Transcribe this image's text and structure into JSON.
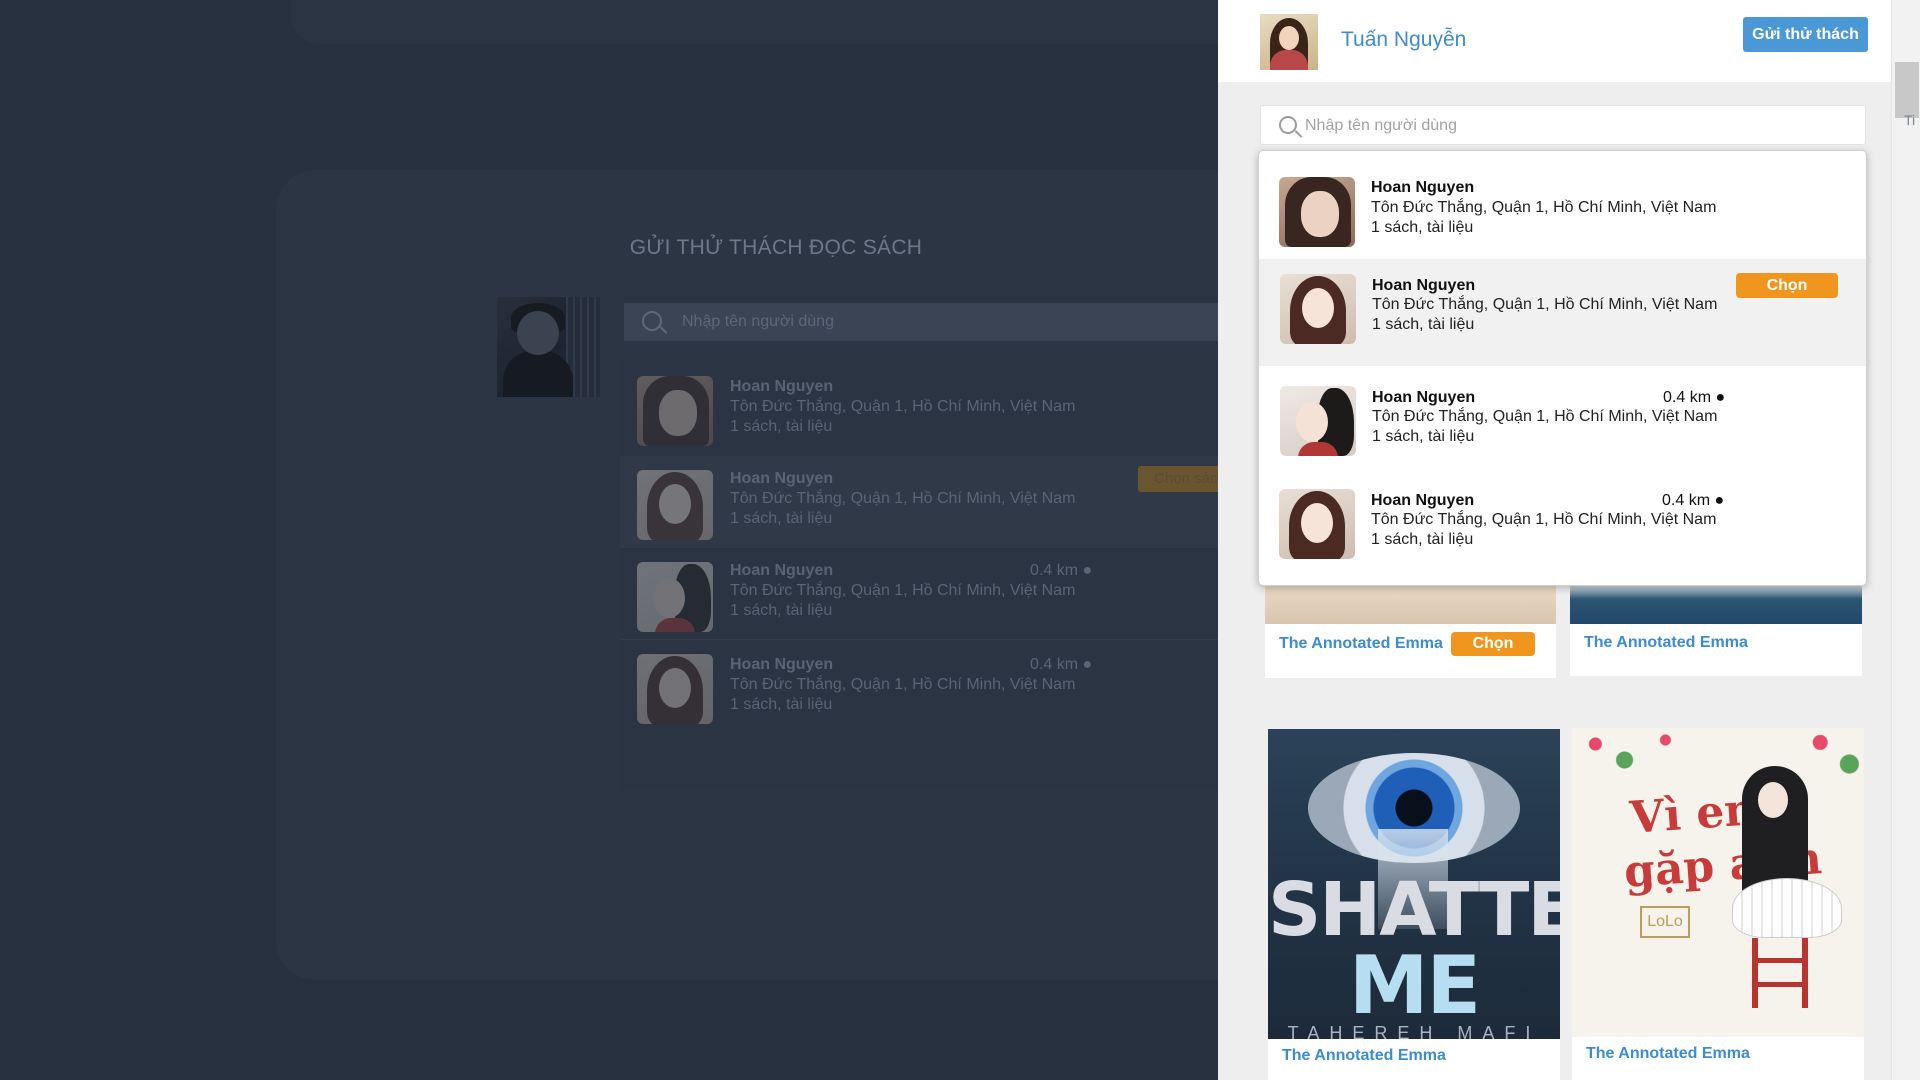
{
  "background": {
    "title": "GỬI THỬ THÁCH ĐỌC SÁCH",
    "search_placeholder": "Nhập tên người dùng",
    "choose_book_label": "Chọn sách",
    "users": [
      {
        "name": "Hoan Nguyen",
        "address": "Tôn Đức Thắng, Quận 1, Hồ Chí Minh, Việt Nam",
        "books": "1 sách, tài liệu",
        "distance": ""
      },
      {
        "name": "Hoan Nguyen",
        "address": "Tôn Đức Thắng, Quận 1, Hồ Chí Minh, Việt Nam",
        "books": "1 sách, tài liệu",
        "distance": ""
      },
      {
        "name": "Hoan Nguyen",
        "address": "Tôn Đức Thắng, Quận 1, Hồ Chí Minh, Việt Nam",
        "books": "1 sách, tài liệu",
        "distance": "0.4 km ●"
      },
      {
        "name": "Hoan Nguyen",
        "address": "Tôn Đức Thắng, Quận 1, Hồ Chí Minh, Việt Nam",
        "books": "1 sách, tài liệu",
        "distance": "0.4 km ●"
      }
    ]
  },
  "panel": {
    "user_name": "Tuấn Nguyễn",
    "challenge_button": "Gửi thử thách",
    "search_placeholder": "Nhập tên người dùng",
    "results": [
      {
        "name": "Hoan Nguyen",
        "address": "Tôn Đức Thắng, Quận 1, Hồ Chí Minh, Việt Nam",
        "books": "1 sách, tài liệu",
        "distance": ""
      },
      {
        "name": "Hoan Nguyen",
        "address": "Tôn Đức Thắng, Quận 1, Hồ Chí Minh, Việt Nam",
        "books": "1 sách, tài liệu",
        "distance": "",
        "button": "Chọn"
      },
      {
        "name": "Hoan Nguyen",
        "address": "Tôn Đức Thắng, Quận 1, Hồ Chí Minh, Việt Nam",
        "books": "1 sách, tài liệu",
        "distance": "0.4 km ●"
      },
      {
        "name": "Hoan Nguyen",
        "address": "Tôn Đức Thắng, Quận 1, Hồ Chí Minh, Việt Nam",
        "books": "1 sách, tài liệu",
        "distance": "0.4 km ●"
      }
    ],
    "books": [
      {
        "title": "The Annotated Emma",
        "button": "Chọn"
      },
      {
        "title": "The Annotated Emma"
      },
      {
        "title": "The Annotated Emma",
        "cover_line1": "SHATTER",
        "cover_line2": "ME",
        "cover_author": "TAHEREH MAFI"
      },
      {
        "title": "The Annotated Emma",
        "cover_line1": "Vì em",
        "cover_line2": "gặp anh",
        "cover_badge": "LoLo"
      }
    ]
  },
  "edge_text": "Ti",
  "colors": {
    "accent_blue": "#4a98d6",
    "link_blue": "#3b8cd0",
    "orange": "#f0961e",
    "overlay": "#283140"
  },
  "icons": [
    "search-icon",
    "user-avatar",
    "scrollbar-thumb"
  ]
}
